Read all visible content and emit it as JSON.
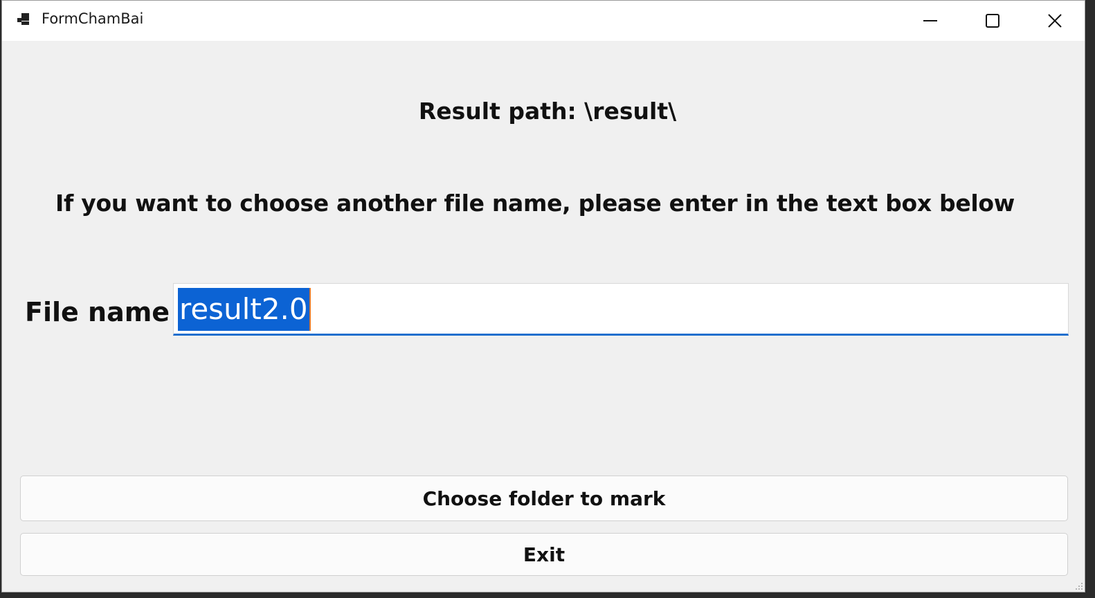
{
  "window": {
    "title": "FormChamBai"
  },
  "titlebar_controls": {
    "minimize_icon": "minimize-icon",
    "maximize_icon": "maximize-icon",
    "close_icon": "close-icon"
  },
  "content": {
    "result_path": "Result path: \\result\\",
    "instruction": "If you want to choose another file name, please enter in the text box below",
    "file_name_label": "File name",
    "file_name_value": "result2.0"
  },
  "buttons": {
    "choose_folder": "Choose folder to mark",
    "exit": "Exit"
  },
  "colors": {
    "selection": "#0c63d4",
    "focus_underline": "#1f6fce",
    "window_bg": "#f0f0f0"
  }
}
